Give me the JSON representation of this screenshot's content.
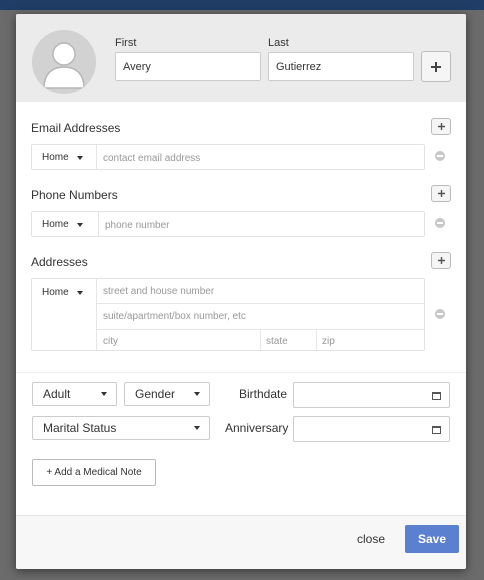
{
  "header": {
    "first_label": "First",
    "first_value": "Avery",
    "last_label": "Last",
    "last_value": "Gutierrez"
  },
  "email": {
    "title": "Email Addresses",
    "type": "Home",
    "placeholder": "contact email address"
  },
  "phone": {
    "title": "Phone Numbers",
    "type": "Home",
    "placeholder": "phone number"
  },
  "address": {
    "title": "Addresses",
    "type": "Home",
    "street_placeholder": "street and house number",
    "suite_placeholder": "suite/apartment/box number, etc",
    "city_placeholder": "city",
    "state_placeholder": "state",
    "zip_placeholder": "zip"
  },
  "details": {
    "age_value": "Adult",
    "gender_value": "Gender",
    "birthdate_label": "Birthdate",
    "marital_value": "Marital Status",
    "anniversary_label": "Anniversary",
    "medical_note_label": "+ Add a Medical Note"
  },
  "footer": {
    "close_label": "close",
    "save_label": "Save"
  },
  "colors": {
    "save_button": "#5b80cf",
    "header_bg": "#ebebeb"
  }
}
